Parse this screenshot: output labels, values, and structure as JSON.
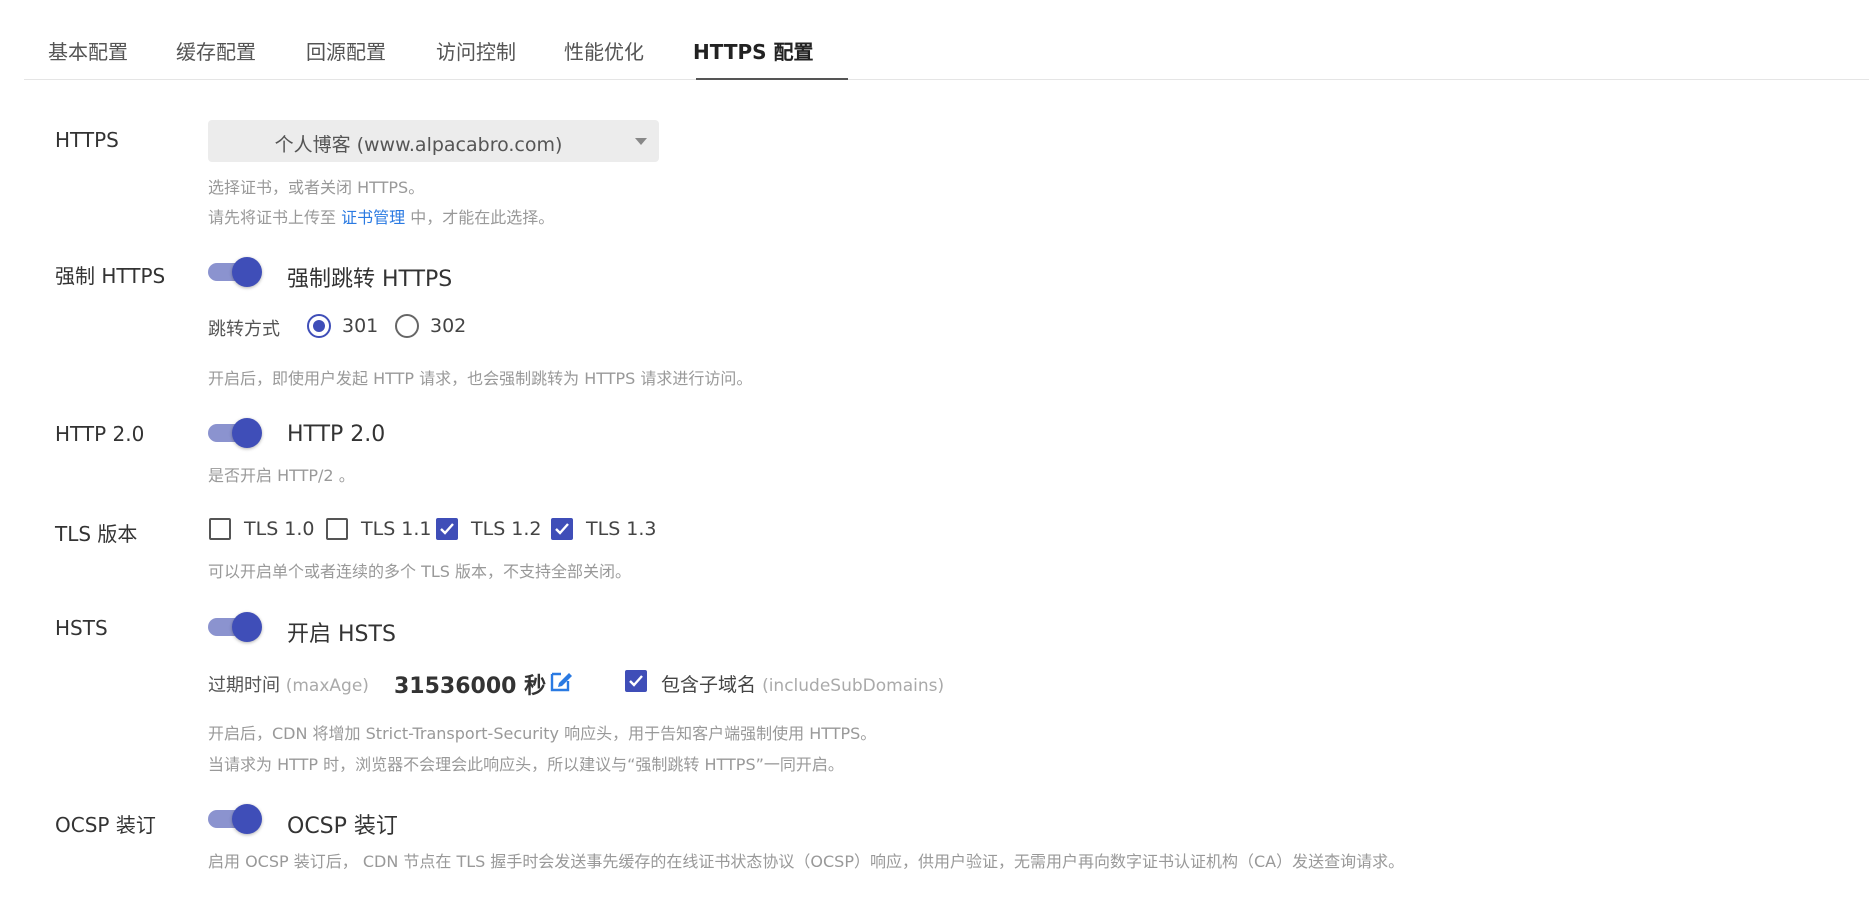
{
  "tabs": [
    {
      "label": "基本配置"
    },
    {
      "label": "缓存配置"
    },
    {
      "label": "回源配置"
    },
    {
      "label": "访问控制"
    },
    {
      "label": "性能优化"
    },
    {
      "label": "HTTPS 配置",
      "active": true
    }
  ],
  "https": {
    "label": "HTTPS",
    "selected_cert": "个人博客 (www.alpacabro.com)",
    "help_line1": "选择证书，或者关闭 HTTPS。",
    "help_line2_prefix": "请先将证书上传至 ",
    "help_link": "证书管理",
    "help_line2_suffix": " 中，才能在此选择。"
  },
  "force_https": {
    "label": "强制 HTTPS",
    "toggle_label": "强制跳转 HTTPS",
    "enabled": true,
    "redirect_label": "跳转方式",
    "redirect_options": [
      "301",
      "302"
    ],
    "redirect_selected": "301",
    "help": "开启后，即使用户发起 HTTP 请求，也会强制跳转为 HTTPS 请求进行访问。"
  },
  "http2": {
    "label": "HTTP 2.0",
    "toggle_label": "HTTP 2.0",
    "enabled": true,
    "help": "是否开启 HTTP/2 。"
  },
  "tls": {
    "label": "TLS 版本",
    "options": [
      {
        "label": "TLS 1.0",
        "checked": false
      },
      {
        "label": "TLS 1.1",
        "checked": false
      },
      {
        "label": "TLS 1.2",
        "checked": true
      },
      {
        "label": "TLS 1.3",
        "checked": true
      }
    ],
    "help": "可以开启单个或者连续的多个 TLS 版本，不支持全部关闭。"
  },
  "hsts": {
    "label": "HSTS",
    "toggle_label": "开启 HSTS",
    "enabled": true,
    "maxage_label": "过期时间",
    "maxage_hint": "(maxAge)",
    "maxage_value": "31536000 秒",
    "include_label": "包含子域名",
    "include_hint": "(includeSubDomains)",
    "include_checked": true,
    "help_line1": "开启后，CDN 将增加 Strict-Transport-Security 响应头，用于告知客户端强制使用 HTTPS。",
    "help_line2": "当请求为 HTTP 时，浏览器不会理会此响应头，所以建议与“强制跳转 HTTPS”一同开启。"
  },
  "ocsp": {
    "label": "OCSP 装订",
    "toggle_label": "OCSP 装订",
    "enabled": true,
    "help": "启用 OCSP 装订后， CDN 节点在 TLS 握手时会发送事先缓存的在线证书状态协议（OCSP）响应，供用户验证，无需用户再向数字证书认证机构（CA）发送查询请求。"
  },
  "colors": {
    "accent": "#3f4eb8",
    "toggle_track": "#8b93cf",
    "link": "#2a7ae2",
    "help_text": "#999999"
  }
}
